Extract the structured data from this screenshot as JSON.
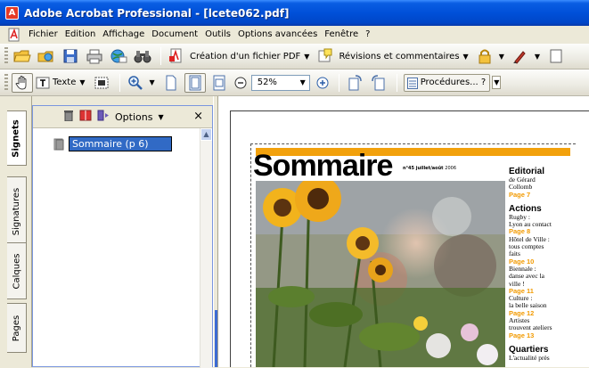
{
  "window": {
    "title": "Adobe Acrobat Professional - [lcete062.pdf]"
  },
  "menu": {
    "items": [
      "Fichier",
      "Edition",
      "Affichage",
      "Document",
      "Outils",
      "Options avancées",
      "Fenêtre",
      "?"
    ]
  },
  "toolbar1": {
    "create_pdf_label": "Création d'un fichier PDF",
    "review_label": "Révisions et commentaires"
  },
  "toolbar2": {
    "text_tool_label": "Texte",
    "zoom_value": "52%",
    "procedures_label": "Procédures...",
    "procedures_help": "?"
  },
  "panel_tabs": [
    "Signets",
    "Signatures",
    "Calques",
    "Pages"
  ],
  "bookmarks_panel": {
    "options_label": "Options",
    "close_label": "×",
    "items": [
      {
        "label": "Sommaire (p 6)"
      }
    ]
  },
  "document": {
    "title": "Sommaire",
    "issue_number": "n°45 juillet/août",
    "issue_year": "2006",
    "sections": [
      {
        "heading": "Editorial",
        "lines": [
          "de Gérard",
          "Collomb"
        ],
        "page": "Page 7"
      },
      {
        "heading": "Actions",
        "lines": [
          "Rugby :",
          "Lyon au contact"
        ],
        "page": "Page 8"
      },
      {
        "heading": "",
        "lines": [
          "Hôtel de Ville :",
          "tous comptes",
          "faits"
        ],
        "page": "Page 10"
      },
      {
        "heading": "",
        "lines": [
          "Biennale :",
          "danse avec la",
          "ville !"
        ],
        "page": "Page 11"
      },
      {
        "heading": "",
        "lines": [
          "Culture :",
          "la belle saison"
        ],
        "page": "Page 12"
      },
      {
        "heading": "",
        "lines": [
          "Artistes",
          "trouvent ateliers"
        ],
        "page": "Page 13"
      },
      {
        "heading": "Quartiers",
        "lines": [
          "L'actualité près"
        ],
        "page": ""
      }
    ]
  },
  "colors": {
    "title_bar": "#0050d8",
    "selection": "#316ac5",
    "accent_orange": "#f2a10c"
  }
}
